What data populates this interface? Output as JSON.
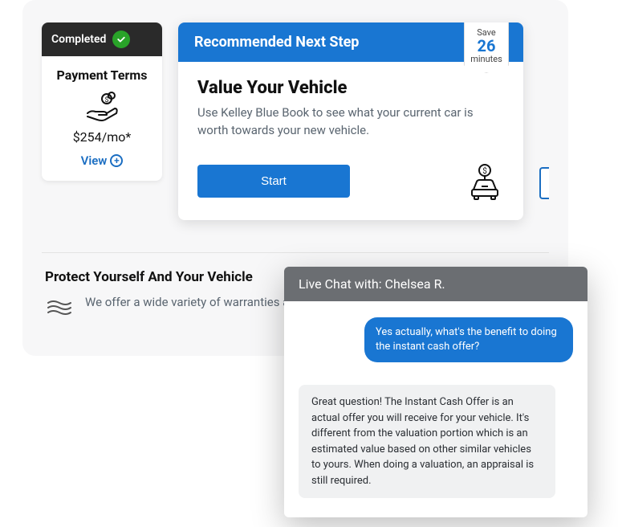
{
  "completed": {
    "badge": "Completed",
    "title": "Payment Terms",
    "price": "$254/mo*",
    "view": "View"
  },
  "recommend": {
    "header": "Recommended Next Step",
    "ribbon_top": "Save",
    "ribbon_num": "26",
    "ribbon_bottom": "minutes",
    "title": "Value Your Vehicle",
    "desc": "Use Kelley Blue Book to see what your current car is worth towards your new vehicle.",
    "start": "Start"
  },
  "protect": {
    "title": "Protect Yourself And Your Vehicle",
    "desc": "We offer a wide variety of warranties and plans to protect your vehicle."
  },
  "chat": {
    "header": "Live Chat with: Chelsea R.",
    "user_msg": "Yes actually, what's the benefit to doing the instant cash offer?",
    "agent_msg": "Great question! The Instant Cash Offer is an actual offer you will receive for your vehicle. It's different from the valuation portion which is an estimated value based on other similar vehicles to yours. When doing a valuation, an appraisal is still required."
  }
}
